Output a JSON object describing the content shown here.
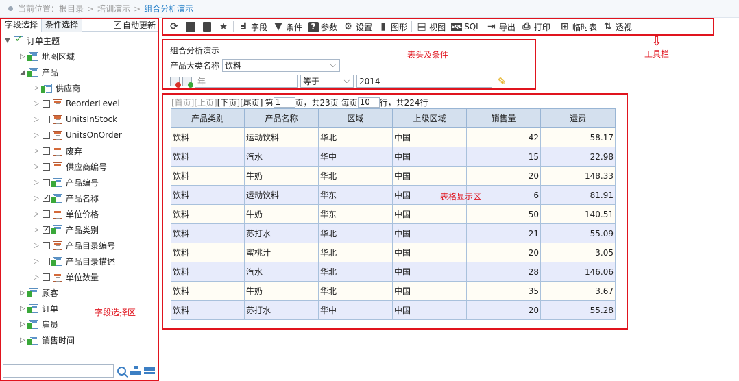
{
  "breadcrumb": {
    "prefix": "当前位置：",
    "items": [
      "根目录",
      "培训演示"
    ],
    "current": "组合分析演示"
  },
  "left_panel": {
    "tabs": [
      "字段选择",
      "条件选择"
    ],
    "auto_refresh": {
      "label": "自动更新",
      "checked": true
    },
    "region_label": "字段选择区",
    "tree": {
      "root": "订单主题",
      "nodes": [
        {
          "label": "地图区域"
        },
        {
          "label": "产品"
        },
        {
          "label": "供应商"
        },
        {
          "label": "ReorderLevel"
        },
        {
          "label": "UnitsInStock"
        },
        {
          "label": "UnitsOnOrder"
        },
        {
          "label": "废弃"
        },
        {
          "label": "供应商编号"
        },
        {
          "label": "产品编号"
        },
        {
          "label": "产品名称"
        },
        {
          "label": "单位价格"
        },
        {
          "label": "产品类别"
        },
        {
          "label": "产品目录编号"
        },
        {
          "label": "产品目录描述"
        },
        {
          "label": "单位数量"
        },
        {
          "label": "顾客"
        },
        {
          "label": "订单"
        },
        {
          "label": "雇员"
        },
        {
          "label": "销售时间"
        }
      ]
    },
    "search": {
      "value": ""
    }
  },
  "toolbar": {
    "items": [
      {
        "icon": "refresh-icon",
        "label": ""
      },
      {
        "icon": "save-icon",
        "label": ""
      },
      {
        "icon": "save-as-icon",
        "label": ""
      },
      {
        "icon": "star-icon",
        "label": ""
      },
      {
        "icon": "field-icon",
        "label": "字段"
      },
      {
        "icon": "filter-icon",
        "label": "条件"
      },
      {
        "icon": "help-icon",
        "label": "参数"
      },
      {
        "icon": "gear-icon",
        "label": "设置"
      },
      {
        "icon": "bar-chart-icon",
        "label": "图形"
      },
      {
        "icon": "view-icon",
        "label": "视图"
      },
      {
        "icon": "sql-icon",
        "label": "SQL"
      },
      {
        "icon": "export-icon",
        "label": "导出"
      },
      {
        "icon": "print-icon",
        "label": "打印"
      },
      {
        "icon": "temp-table-icon",
        "label": "临时表"
      },
      {
        "icon": "pivot-icon",
        "label": "透视"
      }
    ],
    "annotation": "工具栏"
  },
  "condition": {
    "title": "组合分析演示",
    "region_label": "表头及条件",
    "category_label": "产品大类名称",
    "category_value": "饮料",
    "field_placeholder": "年",
    "operator": "等于",
    "value": "2014"
  },
  "table_area": {
    "region_label": "表格显示区",
    "pager": {
      "first": "[首页]",
      "prev": "[上页]",
      "next": "[下页]",
      "last": "[尾页]",
      "page_prefix": "第",
      "page": "1",
      "page_suffix": "页，共23页 每页",
      "per_page": "10",
      "rows_suffix": "行，共224行"
    },
    "columns": [
      "产品类别",
      "产品名称",
      "区域",
      "上级区域",
      "销售量",
      "运费"
    ],
    "rows": [
      [
        "饮料",
        "运动饮料",
        "华北",
        "中国",
        "42",
        "58.17"
      ],
      [
        "饮料",
        "汽水",
        "华中",
        "中国",
        "15",
        "22.98"
      ],
      [
        "饮料",
        "牛奶",
        "华北",
        "中国",
        "20",
        "148.33"
      ],
      [
        "饮料",
        "运动饮料",
        "华东",
        "中国",
        "6",
        "81.91"
      ],
      [
        "饮料",
        "牛奶",
        "华东",
        "中国",
        "50",
        "140.51"
      ],
      [
        "饮料",
        "苏打水",
        "华北",
        "中国",
        "21",
        "55.09"
      ],
      [
        "饮料",
        "蜜桃汁",
        "华北",
        "中国",
        "20",
        "3.05"
      ],
      [
        "饮料",
        "汽水",
        "华北",
        "中国",
        "28",
        "146.06"
      ],
      [
        "饮料",
        "牛奶",
        "华北",
        "中国",
        "35",
        "3.67"
      ],
      [
        "饮料",
        "苏打水",
        "华中",
        "中国",
        "20",
        "55.28"
      ]
    ]
  }
}
